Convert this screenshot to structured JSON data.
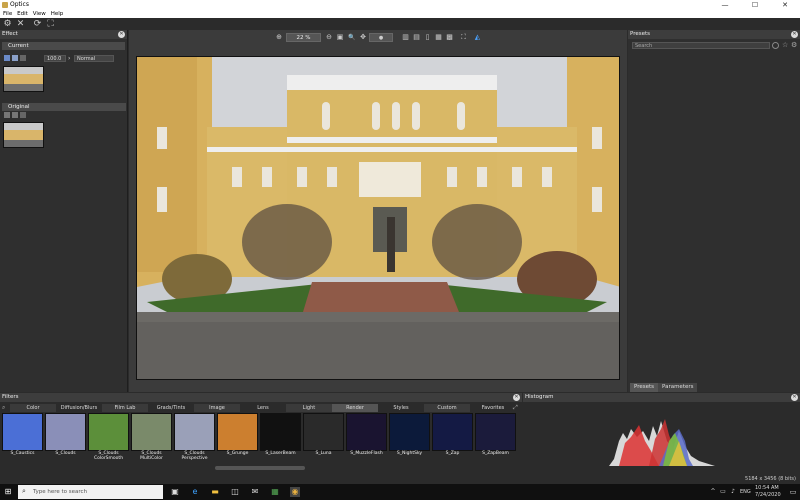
{
  "window": {
    "title": "Optics",
    "controls": [
      "—",
      "☐",
      "✕"
    ]
  },
  "menu": [
    "File",
    "Edit",
    "View",
    "Help"
  ],
  "toolbar": {
    "icons": [
      "gear-icon",
      "close-x-icon",
      "refresh-icon",
      "crop-icon"
    ]
  },
  "effect_panel": {
    "title": "Effect",
    "current_label": "Current",
    "opacity_value": "100.0",
    "blend_mode": "Normal",
    "original_label": "Original"
  },
  "view_toolbar": {
    "zoom": "22 %",
    "zoom_in": "⊕",
    "zoom_out": "⊖",
    "fit": "▣",
    "search": "🔍",
    "move": "✥",
    "channel": "●"
  },
  "presets_panel": {
    "title": "Presets",
    "search_placeholder": "Search",
    "tabs": [
      "Presets",
      "Parameters"
    ]
  },
  "filters_panel": {
    "title": "Filters",
    "tabs": [
      "Color",
      "Diffusion/Blurs",
      "Film Lab",
      "Grads/Tints",
      "Image",
      "Lens",
      "Light",
      "Render",
      "Styles",
      "Custom",
      "Favorites"
    ],
    "items": [
      {
        "name": "S_Caustics",
        "color": "#4b6fd6"
      },
      {
        "name": "S_Clouds",
        "color": "#8a8fb8"
      },
      {
        "name": "S_Clouds ColorSmooth",
        "color": "#5c8f3a"
      },
      {
        "name": "S_Clouds MultiColor",
        "color": "#7a8a6a"
      },
      {
        "name": "S_Clouds Perspective",
        "color": "#9aa0b8"
      },
      {
        "name": "S_Grunge",
        "color": "#cc7f2f"
      },
      {
        "name": "S_LaserBeam",
        "color": "#111111"
      },
      {
        "name": "S_Luna",
        "color": "#2a2a2a"
      },
      {
        "name": "S_MuzzleFlash",
        "color": "#1a1430"
      },
      {
        "name": "S_NightSky",
        "color": "#0c1a3a"
      },
      {
        "name": "S_Zap",
        "color": "#141a44"
      },
      {
        "name": "S_ZapBeam",
        "color": "#1b1b3b"
      }
    ]
  },
  "histogram_panel": {
    "title": "Histogram"
  },
  "status": {
    "image_info": "5184 x 3456 (8 bits)"
  },
  "taskbar": {
    "search_placeholder": "Type here to search",
    "lang": "ENG",
    "time": "10:54 AM",
    "date": "7/24/2020"
  }
}
